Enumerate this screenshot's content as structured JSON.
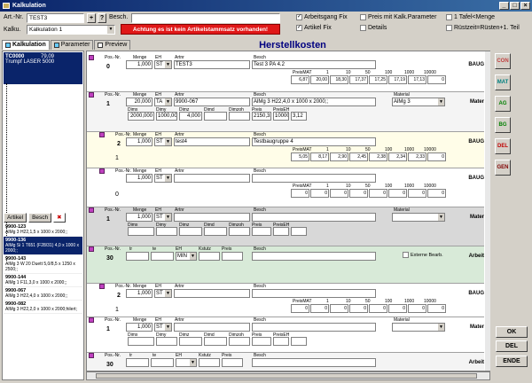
{
  "window": {
    "title": "Kalkulation"
  },
  "header": {
    "art_nr_label": "Art.-Nr.",
    "art_nr_value": "TEST3",
    "plus_label": "+",
    "help_label": "?",
    "besch_label": "Besch.",
    "besch_value": "",
    "kalku_label": "Kalku.",
    "kalku_value": "Kalkulation 1",
    "warning": "Achtung es ist kein Artikelstammsatz vorhanden!"
  },
  "options": {
    "arbeitsgang_fix": "Arbeitsgang Fix",
    "artikel_fix": "Artikel Fix",
    "preis_mit_kalk": "Preis mit Kalk.Parameter",
    "details": "Details",
    "tafel": "1 Tafel<Menge",
    "ruestzeit": "Rüstzeit=Rüsten+1. Teil",
    "check": "✓"
  },
  "tabs": [
    "Kalkulation",
    "Parameter",
    "Preview"
  ],
  "heading": "Herstellkosten",
  "left": {
    "top_code": "TC0000",
    "top_value": "79,09",
    "top_desc": "Trumpf LASER 5000",
    "hdr_artikel": "Artikel",
    "hdr_besch": "Besch",
    "items": [
      {
        "code": "9900-123",
        "desc": "AlMg 3 H22,1,5 x 1000 x 2000;;"
      },
      {
        "code": "9900-136",
        "desc": "AlMg Si 1 T651 (F28/31) 4,0 x 1000 x 2000;;"
      },
      {
        "code": "9900-143",
        "desc": "AlMg 3 W 20 Duett 5,0/8,5 x 1250 x 2500;;"
      },
      {
        "code": "9900-144",
        "desc": "AlMg 1 F11,3,0 x 1000 x 2000;;"
      },
      {
        "code": "9900-067",
        "desc": "AlMg 3 H22,4,0 x 1000 x 2000;;"
      },
      {
        "code": "9900-082",
        "desc": "AlMg 3 H22,2,0 x 1000 x 2000;hilert;"
      }
    ]
  },
  "captions": {
    "posnr": "Pos.-Nr.",
    "menge": "Menge",
    "eh": "EH",
    "artnr": "Artnr",
    "besch": "Besch",
    "material": "Material",
    "dimx": "Dimx",
    "dimy": "Dimy",
    "dimz": "Dimz",
    "dimd": "Dimd",
    "dimzoh": "Dimzoh",
    "preis": "Preis",
    "preiseh": "PreisEH",
    "preismat": "PreisMAT",
    "tr": "tr",
    "te": "te",
    "kstuetz": "Kstutz",
    "extbearb": "Externe Bearb."
  },
  "price_cols": [
    "1",
    "10",
    "50",
    "100",
    "1000",
    "10000"
  ],
  "blocks": [
    {
      "pos": "0",
      "menge": "1,000",
      "eh": "ST",
      "artnr": "TEST3",
      "besch": "Test 3 PA 4.2",
      "tag": "BAUG",
      "prices": [
        "6,87",
        "20,00",
        "18,30",
        "17,37",
        "17,25",
        "17,19",
        "17,13",
        "0"
      ]
    },
    {
      "pos": "1",
      "menge": "20,000",
      "eh": "TA",
      "artnr": "9900-067",
      "besch": "AlMg 3 H22,4,0 x 1000 x 2000;;",
      "material": "AlMg 3",
      "tag": "Mater",
      "dimx": "2000,000",
      "dimy": "1000,000",
      "dimz": "4,000",
      "preis": "2150,33",
      "preiseh": "10000",
      "preiseh2": "3,12"
    },
    {
      "pos": "2",
      "sub": "1",
      "menge": "1,000",
      "eh": "ST",
      "artnr": "test4",
      "besch": "Testbaugruppe 4",
      "tag": "BAUG",
      "prices": [
        "5,05",
        "8,17",
        "2,90",
        "2,45",
        "2,38",
        "2,34",
        "2,33",
        "0"
      ]
    },
    {
      "pos": "",
      "sub": "0",
      "menge": "1,000",
      "eh": "ST",
      "tag": "BAUG",
      "prices": [
        "0",
        "0",
        "0",
        "0",
        "0",
        "0",
        "0",
        "0"
      ]
    },
    {
      "pos": "1",
      "menge": "1,000",
      "eh": "ST",
      "tag": "Mater"
    },
    {
      "pos": "30",
      "eh": "MIN",
      "extbearb": "Externe Bearb.",
      "tag": "Arbeit"
    },
    {
      "pos": "2",
      "sub": "1",
      "menge": "1,000",
      "eh": "ST",
      "tag": "BAUG",
      "prices": [
        "0",
        "0",
        "0",
        "0",
        "0",
        "0",
        "0",
        "0"
      ]
    },
    {
      "pos": "1",
      "menge": "1,000",
      "eh": "ST",
      "tag": "Mater"
    },
    {
      "pos": "30",
      "tag": "Arbeit"
    }
  ],
  "side_buttons": [
    "CON",
    "MAT",
    "AG",
    "BG",
    "DEL",
    "GEN"
  ],
  "bottom_buttons": [
    "OK",
    "DEL",
    "ENDE"
  ],
  "colors": {
    "accent": "#0a246a",
    "warning": "#e01818",
    "heading": "#000080",
    "marker": "#c040c0"
  }
}
